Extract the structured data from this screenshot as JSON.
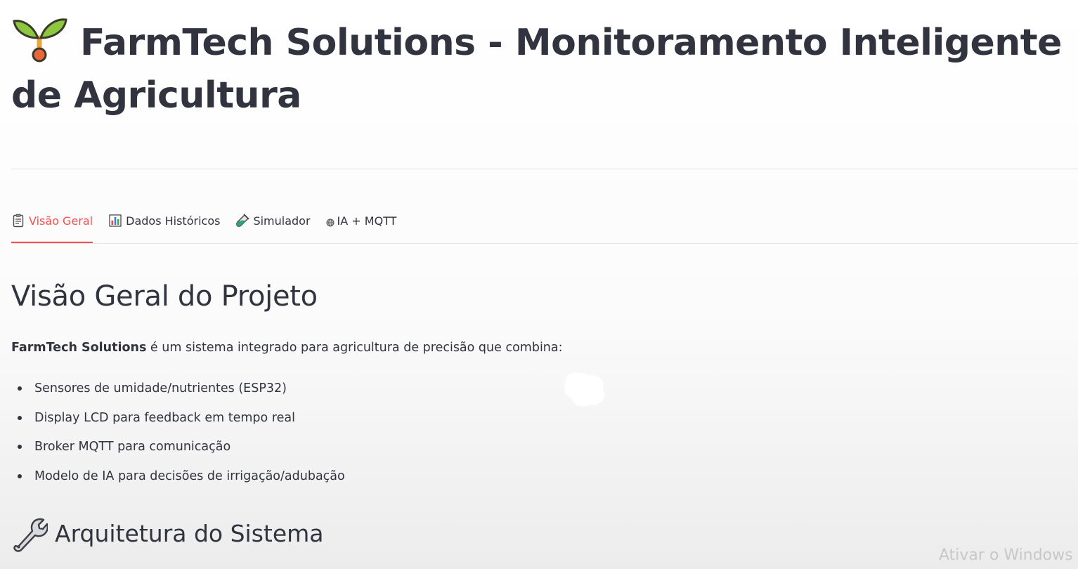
{
  "header": {
    "title": "FarmTech Solutions - Monitoramento Inteligente de Agricultura",
    "icon": "seedling-icon"
  },
  "tabs": [
    {
      "label": "Visão Geral",
      "icon": "clipboard-icon",
      "active": true
    },
    {
      "label": "Dados Históricos",
      "icon": "bar-chart-icon",
      "active": false
    },
    {
      "label": "Simulador",
      "icon": "test-tube-icon",
      "active": false
    },
    {
      "label": "IA + MQTT",
      "icon": "globe-icon",
      "active": false
    }
  ],
  "overview": {
    "title": "Visão Geral do Projeto",
    "intro_strong": "FarmTech Solutions",
    "intro_rest": " é um sistema integrado para agricultura de precisão que combina:",
    "features": [
      "Sensores de umidade/nutrientes (ESP32)",
      "Display LCD para feedback em tempo real",
      "Broker MQTT para comunicação",
      "Modelo de IA para decisões de irrigação/adubação"
    ]
  },
  "architecture": {
    "title": "Arquitetura do Sistema",
    "icon": "wrench-icon"
  },
  "watermark": "Ativar o Windows",
  "colors": {
    "accent": "#ff4b4b",
    "text": "#31333f",
    "divider": "#e4e4e4"
  }
}
